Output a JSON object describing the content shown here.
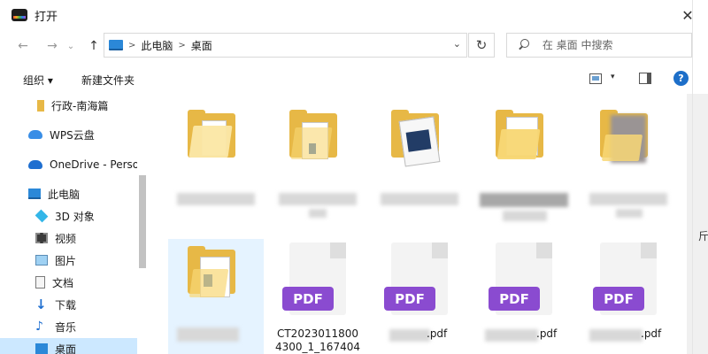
{
  "window": {
    "title": "打开"
  },
  "addressbar": {
    "crumbs": [
      "此电脑",
      "桌面"
    ],
    "search_placeholder": "在 桌面 中搜索"
  },
  "toolbar": {
    "organize_label": "组织 ▾",
    "new_folder_label": "新建文件夹"
  },
  "sidebar": {
    "items": [
      {
        "label": "行政-南海篇",
        "icon": "folder-icon"
      },
      {
        "label": "WPS云盘",
        "icon": "cloud-icon"
      },
      {
        "label": "OneDrive - Perso",
        "icon": "onedrive-icon"
      },
      {
        "label": "此电脑",
        "icon": "computer-icon"
      },
      {
        "label": "3D 对象",
        "icon": "cube-icon"
      },
      {
        "label": "视频",
        "icon": "video-icon"
      },
      {
        "label": "图片",
        "icon": "picture-icon"
      },
      {
        "label": "文档",
        "icon": "document-icon"
      },
      {
        "label": "下载",
        "icon": "download-icon"
      },
      {
        "label": "音乐",
        "icon": "music-icon"
      },
      {
        "label": "桌面",
        "icon": "desktop-icon"
      }
    ]
  },
  "files": [
    {
      "type": "folder",
      "caption": ""
    },
    {
      "type": "folder",
      "caption": ""
    },
    {
      "type": "folder",
      "caption": ""
    },
    {
      "type": "folder",
      "caption": ""
    },
    {
      "type": "folder",
      "caption": ""
    },
    {
      "type": "folder",
      "caption": ""
    },
    {
      "type": "pdf",
      "badge": "PDF",
      "caption": "CT2023011800 4300_1_167404"
    },
    {
      "type": "pdf",
      "badge": "PDF",
      "caption": ".pdf"
    },
    {
      "type": "pdf",
      "badge": "PDF",
      "caption": ".pdf"
    },
    {
      "type": "pdf",
      "badge": "PDF",
      "caption": ".pdf"
    }
  ],
  "edge_text": "斤",
  "colors": {
    "folder": "#f8d775",
    "pdf_badge": "#8a4bd0",
    "selection": "#cce8ff",
    "accent": "#1d6fc9"
  }
}
